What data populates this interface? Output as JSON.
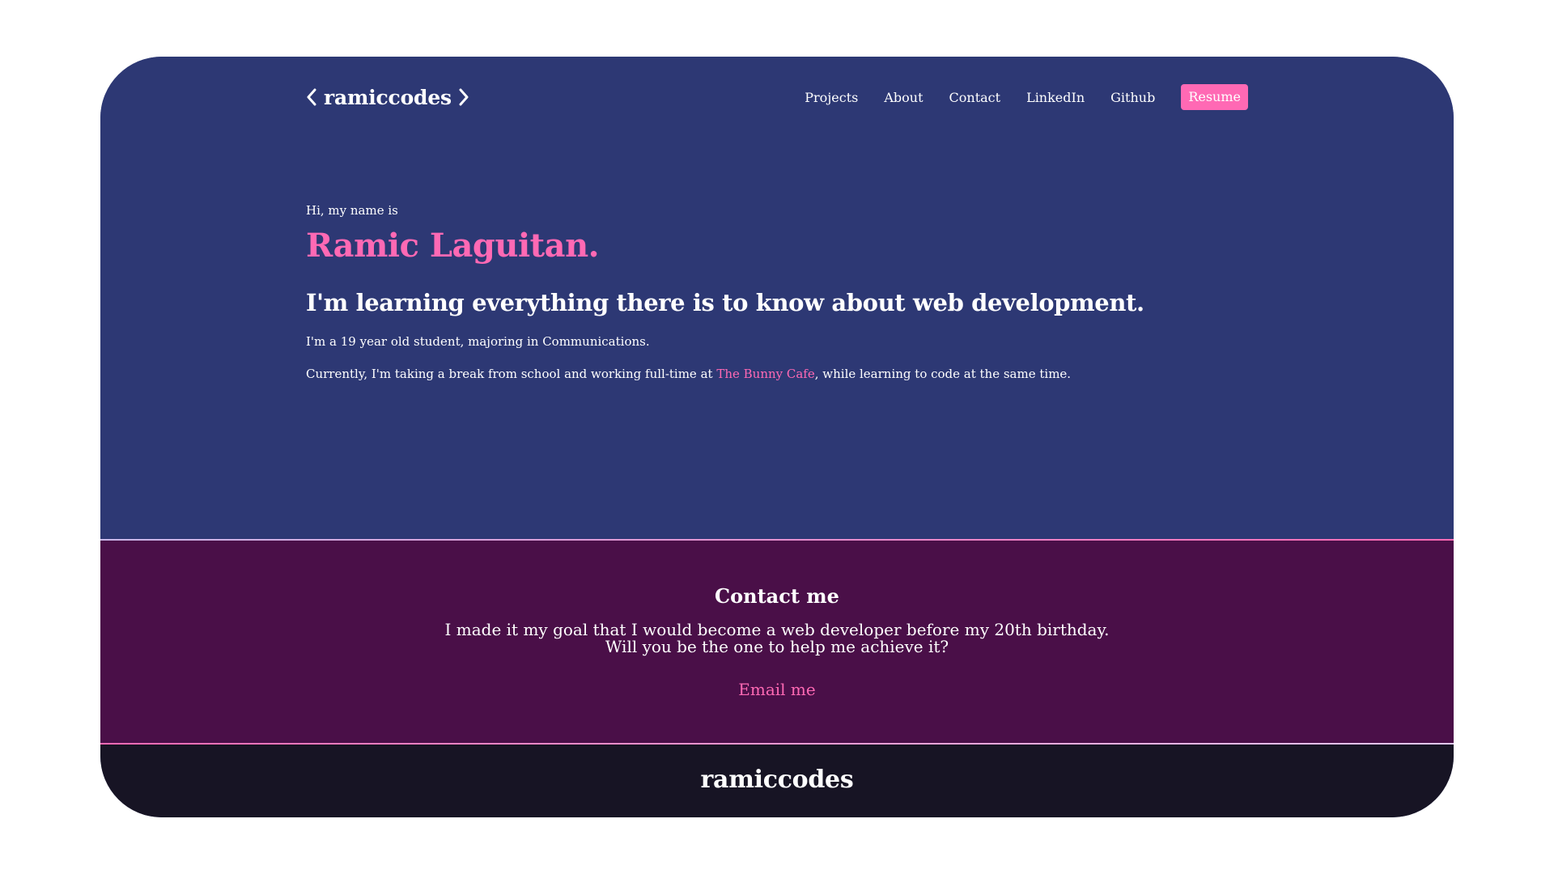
{
  "nav": {
    "logo_text": "ramiccodes",
    "links": [
      "Projects",
      "About",
      "Contact",
      "LinkedIn",
      "Github"
    ],
    "resume_label": "Resume"
  },
  "hero": {
    "greeting": "Hi, my name is",
    "name": "Ramic Laguitan.",
    "tagline": "I'm learning everything there is to know about web development.",
    "paragraph1": "I'm a 19 year old student, majoring in Communications.",
    "paragraph2_before": "Currently, I'm taking a break from school and working full-time at ",
    "paragraph2_link": "The Bunny Cafe",
    "paragraph2_after": ", while learning to code at the same time."
  },
  "contact": {
    "title": "Contact me",
    "line1": "I made it my goal that I would become a web developer before my 20th birthday.",
    "line2": "Will you be the one to help me achieve it?",
    "email_label": "Email me"
  },
  "footer": {
    "logo_text": "ramiccodes"
  },
  "colors": {
    "hero_bg": "#2d3874",
    "contact_bg": "#4a0f48",
    "footer_bg": "#171424",
    "accent": "#ff69b4",
    "text": "#ffffff"
  },
  "icons": {
    "logo_left": "chevron-left-icon",
    "logo_right": "chevron-right-icon"
  }
}
